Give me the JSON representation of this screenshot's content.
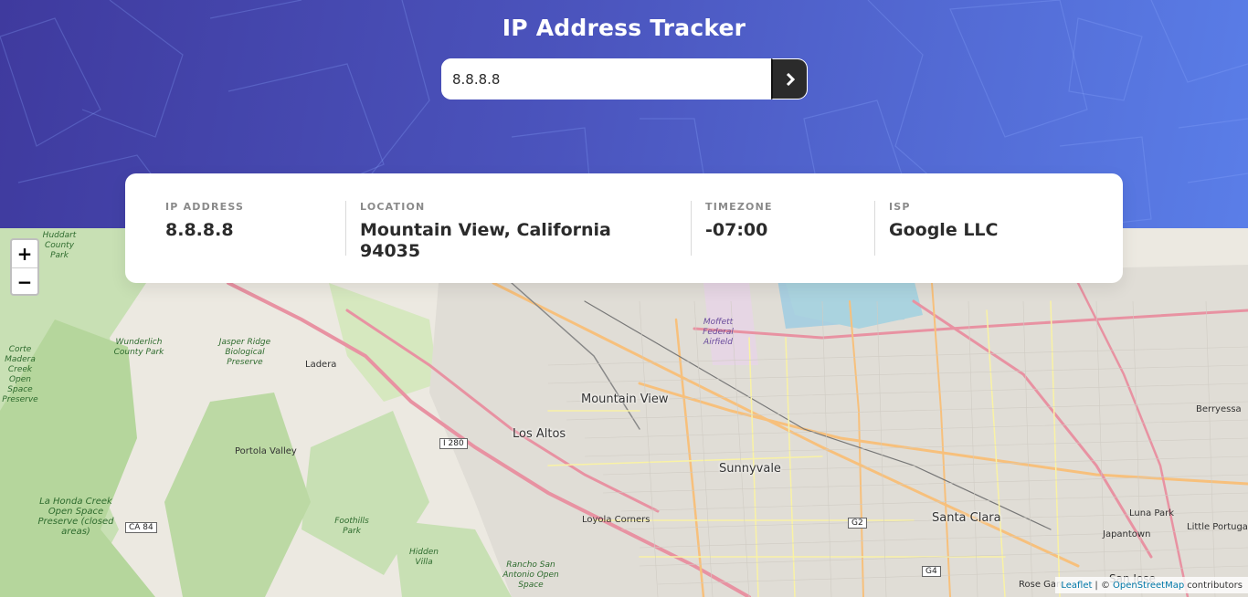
{
  "app": {
    "title": "IP Address Tracker"
  },
  "search": {
    "value": "8.8.8.8",
    "submit_icon": "chevron-right-icon"
  },
  "info": {
    "ip": {
      "label": "IP ADDRESS",
      "value": "8.8.8.8"
    },
    "location": {
      "label": "LOCATION",
      "value_line1": "Mountain View, California",
      "value_line2": "94035"
    },
    "timezone": {
      "label": "TIMEZONE",
      "value": "-07:00"
    },
    "isp": {
      "label": "ISP",
      "value": "Google LLC"
    }
  },
  "map": {
    "zoom_in": "+",
    "zoom_out": "−",
    "places": {
      "mountain_view": "Mountain View",
      "los_altos": "Los Altos",
      "sunnyvale": "Sunnyvale",
      "santa_clara": "Santa Clara",
      "portola_valley": "Portola Valley",
      "ladera": "Ladera",
      "loyola_corners": "Loyola Corners",
      "luna_park": "Luna Park",
      "japantown": "Japantown",
      "little_portugal": "Little Portuga",
      "berryessa": "Berryessa",
      "san_jose": "San Jose",
      "rose_garden": "Rose Garc",
      "moffett": "Moffett Federal Airfield",
      "jasper_ridge": "Jasper Ridge Biological Preserve",
      "wunderlich": "Wunderlich County Park",
      "huddart": "Huddart County Park",
      "la_honda": "La Honda Creek Open Space Preserve (closed areas)",
      "foothills": "Foothills Park",
      "hidden_villa": "Hidden Villa",
      "rancho": "Rancho San Antonio Open Space",
      "corte_madera": "Corte Madera Creek Open Space Preserve"
    },
    "shields": {
      "i280": "I 280",
      "ca84": "CA 84",
      "g2": "G2",
      "g4": "G4"
    },
    "attribution": {
      "leaflet": "Leaflet",
      "sep": "| ©",
      "osm": "OpenStreetMap",
      "contributors": "contributors"
    }
  },
  "colors": {
    "hero_start": "#3f3a9e",
    "hero_end": "#5a7ee8",
    "button": "#2b2b2b",
    "text_dark": "#2b2b2b",
    "label_gray": "#8a8a8a"
  }
}
